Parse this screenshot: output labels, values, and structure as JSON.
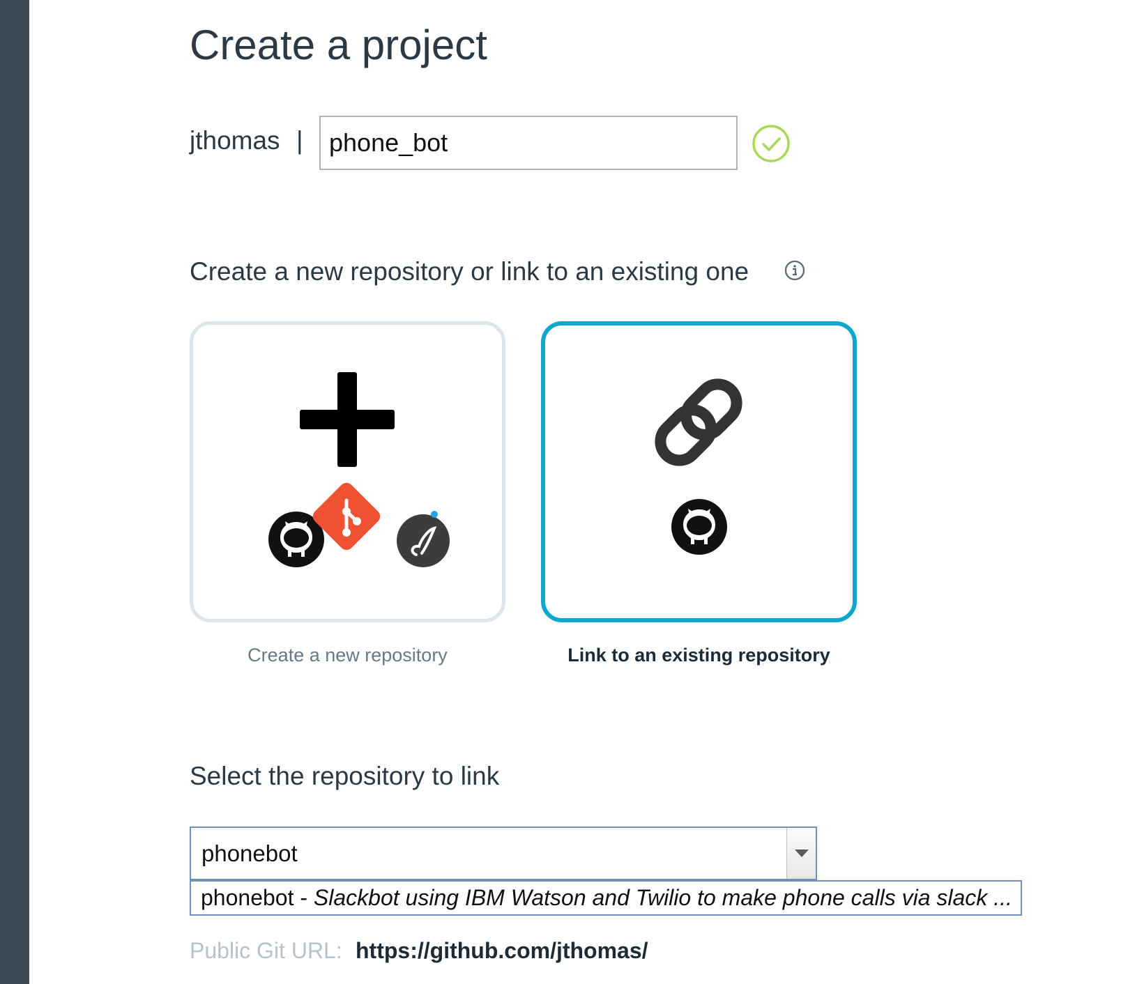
{
  "header": {
    "title": "Create a project"
  },
  "project": {
    "owner": "jthomas",
    "separator": "|",
    "name": "phone_bot"
  },
  "repo_choice": {
    "heading": "Create a new repository or link to an existing one",
    "new_card": {
      "label": "Create a new repository",
      "icons": [
        "plus-icon",
        "github-icon",
        "git-icon",
        "jazzhub-icon"
      ]
    },
    "link_card": {
      "label": "Link to an existing repository",
      "selected": true,
      "icons": [
        "link-icon",
        "github-icon"
      ]
    }
  },
  "select_repo": {
    "heading": "Select the repository to link",
    "search_value": "phonebot",
    "option_name": "phonebot - ",
    "option_description": "Slackbot using IBM Watson and Twilio to make phone calls via slack ..."
  },
  "git_url": {
    "label": "Public Git URL:",
    "value": "https://github.com/jthomas/"
  },
  "colors": {
    "accent": "#0fa7cf",
    "valid": "#a6d95a",
    "git": "#f05133",
    "sidebar": "#3b4a52"
  }
}
